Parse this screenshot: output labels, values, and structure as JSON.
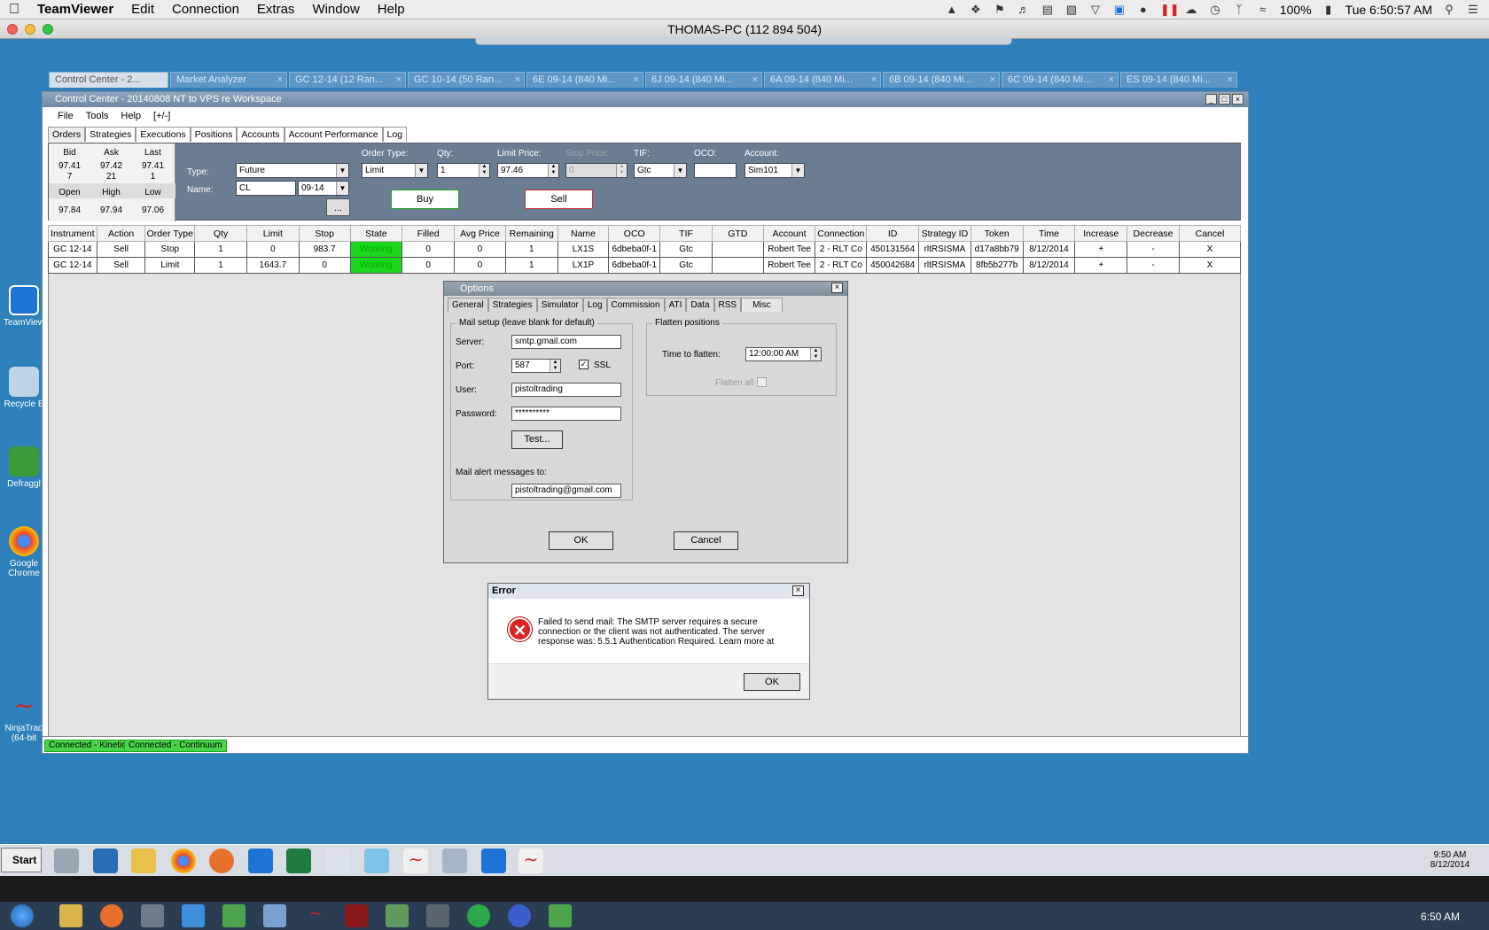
{
  "mac_menubar": {
    "apple": "",
    "app": "TeamViewer",
    "menus": [
      "Edit",
      "Connection",
      "Extras",
      "Window",
      "Help"
    ],
    "battery": "100%",
    "clock": "Tue 6:50:57 AM"
  },
  "teamviewer": {
    "title": "THOMAS-PC (112 894 504)"
  },
  "desktop_icons": [
    {
      "label": "TeamView"
    },
    {
      "label": "Recycle B"
    },
    {
      "label": "Defraggl"
    },
    {
      "label": "Google Chrome"
    },
    {
      "label": "NinjaTrad (64-bit"
    }
  ],
  "doc_tabs": [
    "Control Center - 2...",
    "Market Analyzer",
    "GC 12-14 (12 Ran...",
    "GC 10-14 (50 Ran...",
    "6E 09-14 (840 Mi...",
    "6J 09-14 (840 Mi...",
    "6A 09-14 (840 Mi...",
    "6B 09-14 (840 Mi...",
    "6C 09-14 (840 Mi...",
    "ES 09-14 (840 Mi..."
  ],
  "window": {
    "title": "Control Center - 20140808 NT to VPS re Workspace",
    "menu": [
      "File",
      "Tools",
      "Help",
      "[+/-]"
    ],
    "tabs": [
      "Orders",
      "Strategies",
      "Executions",
      "Positions",
      "Accounts",
      "Account Performance",
      "Log"
    ]
  },
  "quote": {
    "bid_label": "Bid",
    "ask_label": "Ask",
    "last_label": "Last",
    "bid": "97.41",
    "ask": "97.42",
    "last": "97.41",
    "bid_size": "7",
    "ask_size": "21",
    "last_size": "1",
    "open_label": "Open",
    "high_label": "High",
    "low_label": "Low",
    "open": "97.84",
    "high": "97.94",
    "low": "97.06"
  },
  "order_entry": {
    "type_label": "Type:",
    "type_value": "Future",
    "name_label": "Name:",
    "name_value": "CL",
    "expiry": "09-14",
    "order_type_label": "Order Type:",
    "order_type": "Limit",
    "qty_label": "Qty:",
    "qty": "1",
    "limit_label": "Limit Price:",
    "limit": "97.46",
    "stop_label": "Stop Price:",
    "stop": "0",
    "tif_label": "TIF:",
    "tif": "Gtc",
    "oco_label": "OCO:",
    "oco": "",
    "account_label": "Account:",
    "account": "Sim101",
    "ellipsis": "...",
    "buy": "Buy",
    "sell": "Sell"
  },
  "orders_table": {
    "columns": [
      "Instrument",
      "Action",
      "Order Type",
      "Qty",
      "Limit",
      "Stop",
      "State",
      "Filled",
      "Avg Price",
      "Remaining",
      "Name",
      "OCO",
      "TIF",
      "GTD",
      "Account",
      "Connection",
      "ID",
      "Strategy ID",
      "Token",
      "Time",
      "Increase",
      "Decrease",
      "Cancel"
    ],
    "rows": [
      [
        "GC 12-14",
        "Sell",
        "Stop",
        "1",
        "0",
        "983.7",
        "Working",
        "0",
        "0",
        "1",
        "LX1S",
        "6dbeba0f-1",
        "Gtc",
        "",
        "Robert Tee",
        "2 - RLT Co",
        "450131564",
        "rltRSISMA",
        "d17a8bb79",
        "8/12/2014",
        "+",
        "-",
        "X"
      ],
      [
        "GC 12-14",
        "Sell",
        "Limit",
        "1",
        "1643.7",
        "0",
        "Working",
        "0",
        "0",
        "1",
        "LX1P",
        "6dbeba0f-1",
        "Gtc",
        "",
        "Robert Tee",
        "2 - RLT Co",
        "450042684",
        "rltRSISMA",
        "8fb5b277b",
        "8/12/2014",
        "+",
        "-",
        "X"
      ]
    ]
  },
  "status": [
    "Connected - Kinetick",
    "Connected - Continuum"
  ],
  "options": {
    "title": "Options",
    "tabs": [
      "General",
      "Strategies",
      "Simulator",
      "Log",
      "Commission",
      "ATI",
      "Data",
      "RSS",
      "Misc"
    ],
    "mail_group": "Mail setup (leave blank for default)",
    "server_label": "Server:",
    "server": "smtp.gmail.com",
    "port_label": "Port:",
    "port": "587",
    "ssl": "SSL",
    "user_label": "User:",
    "user": "pistoltrading",
    "password_label": "Password:",
    "password": "**********",
    "test": "Test...",
    "alert_label": "Mail alert messages to:",
    "alert": "pistoltrading@gmail.com",
    "flatten_group": "Flatten positions",
    "time_label": "Time to flatten:",
    "time": "12:00:00 AM",
    "flatten_all": "Flatten all",
    "ok": "OK",
    "cancel": "Cancel"
  },
  "error": {
    "title": "Error",
    "message": "Failed to send mail: The SMTP server requires a secure connection or the client was not authenticated. The server response was: 5.5.1 Authentication Required. Learn more at",
    "ok": "OK"
  },
  "taskbar": {
    "start": "Start",
    "time": "9:50 AM",
    "date": "8/12/2014",
    "w7_time": "6:50 AM"
  }
}
